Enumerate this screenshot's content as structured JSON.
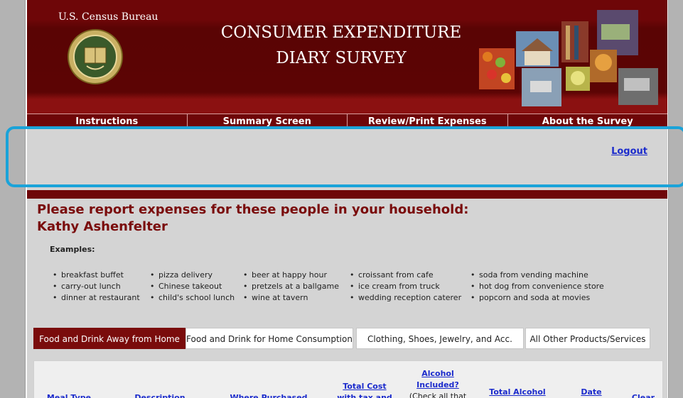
{
  "header": {
    "bureau": "U.S. Census Bureau",
    "title_line1": "CONSUMER EXPENDITURE",
    "title_line2": "DIARY SURVEY"
  },
  "nav": [
    {
      "label": "Instructions"
    },
    {
      "label": "Summary Screen"
    },
    {
      "label": "Review/Print Expenses"
    },
    {
      "label": "About the Survey"
    }
  ],
  "logout": "Logout",
  "main": {
    "heading": "Please report expenses for these people in your household:",
    "person": "Kathy Ashenfelter",
    "examples_label": "Examples:",
    "examples": [
      [
        "breakfast buffet",
        "carry-out lunch",
        "dinner at restaurant"
      ],
      [
        "pizza delivery",
        "Chinese takeout",
        "child's school lunch"
      ],
      [
        "beer at happy hour",
        "pretzels at a ballgame",
        "wine at tavern"
      ],
      [
        "croissant from cafe",
        "ice cream from truck",
        "wedding reception caterer"
      ],
      [
        "soda from vending machine",
        "hot dog from convenience store",
        "popcorn and soda at movies"
      ]
    ]
  },
  "tabs": [
    {
      "label": "Food and Drink Away from Home"
    },
    {
      "label": "Food and Drink for Home Consumption"
    },
    {
      "label": "Clothing, Shoes, Jewelry, and Acc."
    },
    {
      "label": "All Other Products/Services"
    }
  ],
  "table": {
    "headers": {
      "meal_type": "Meal Type",
      "description": "Description",
      "where": "Where Purchased",
      "total_cost": "Total Cost",
      "total_cost_2": "with tax and",
      "alcohol": "Alcohol",
      "alcohol_2": "Included?",
      "alcohol_note": "(Check all that",
      "total_alcohol": "Total Alcohol",
      "date": "Date",
      "clear": "Clear"
    }
  },
  "colors": {
    "header_red": "#6e0608",
    "heading_red": "#7a0c0c",
    "link_blue": "#1b2bcc",
    "highlight": "#1aa3d9"
  }
}
